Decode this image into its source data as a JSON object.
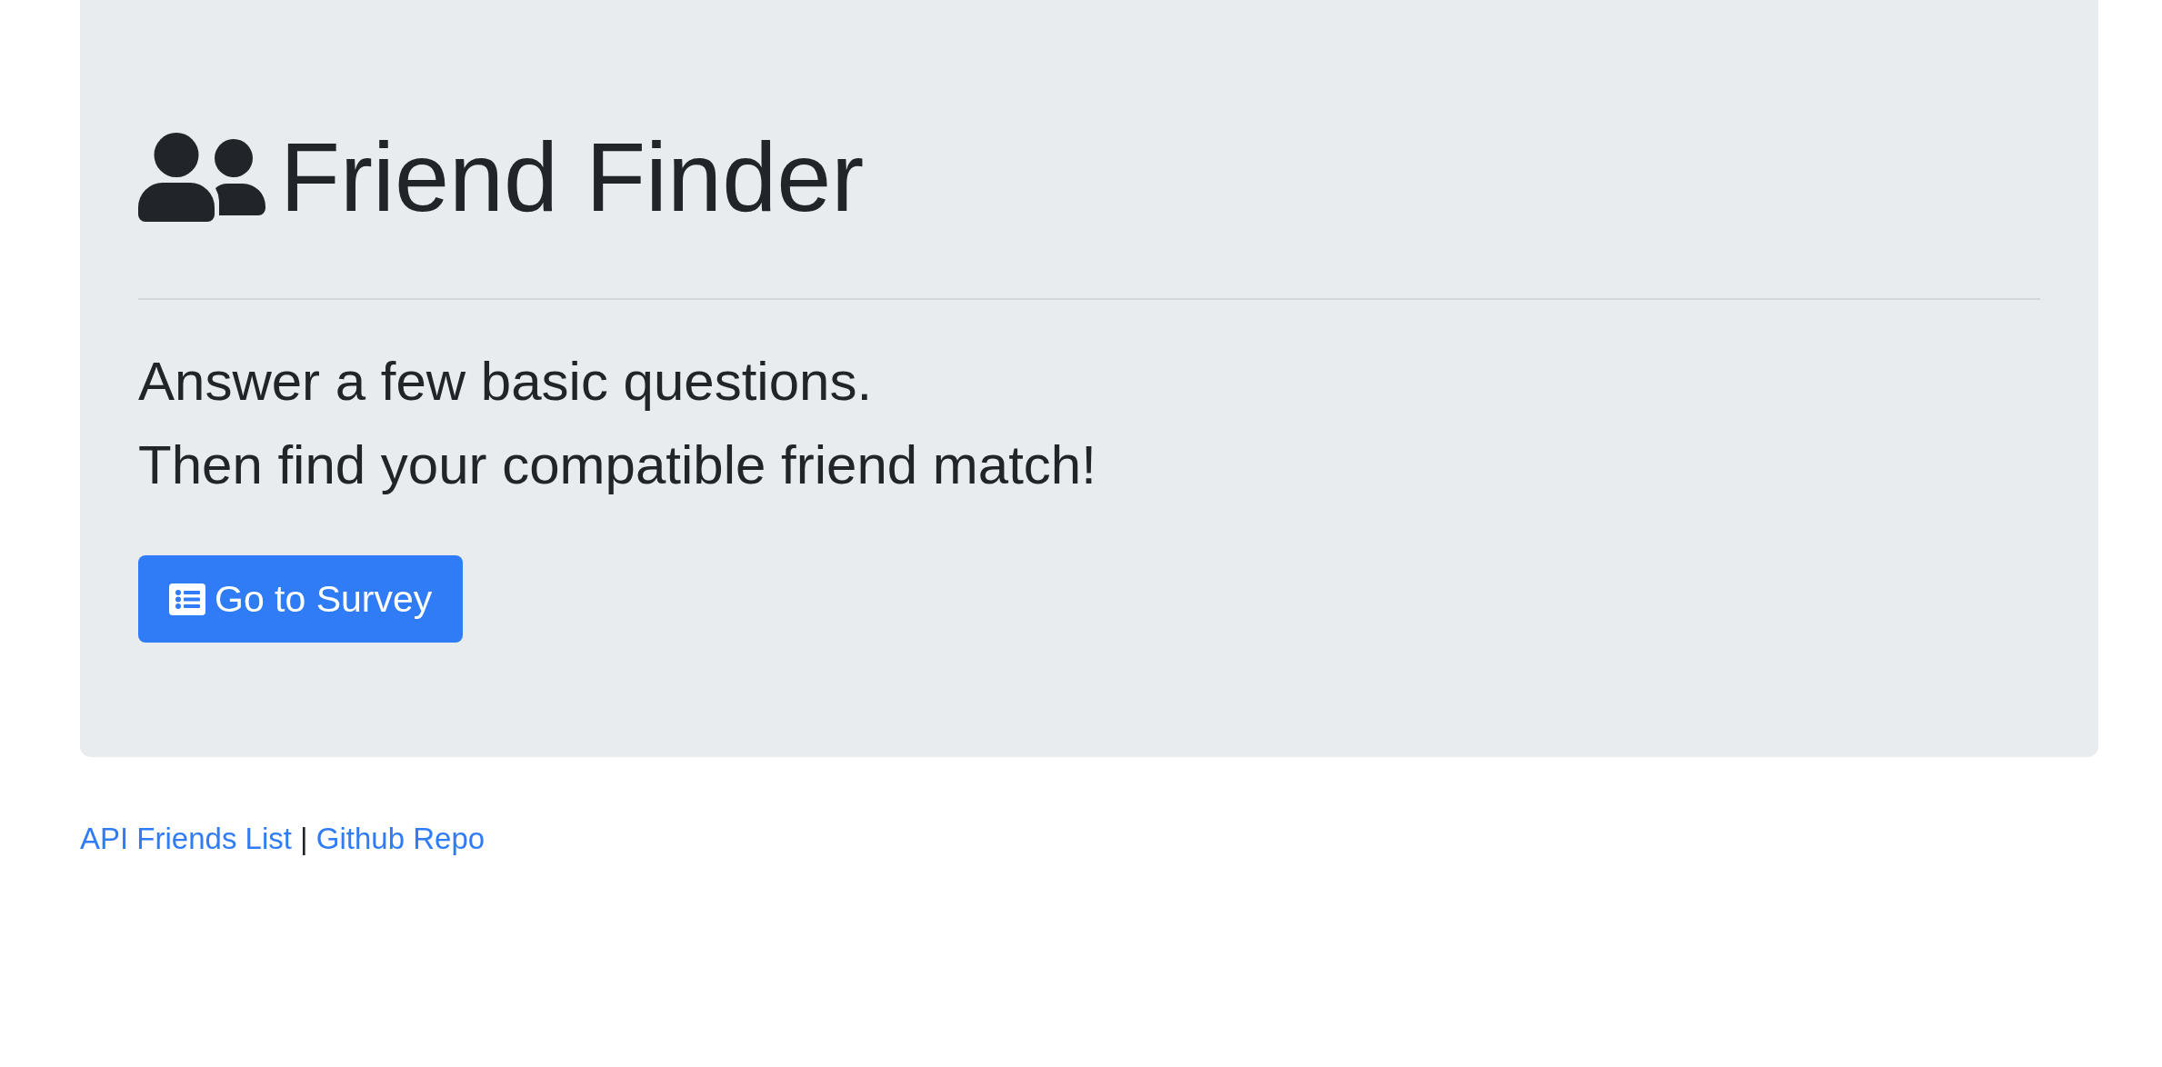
{
  "header": {
    "title": "Friend Finder"
  },
  "lead": [
    "Answer a few basic questions.",
    "Then find your compatible friend match!"
  ],
  "survey_button": {
    "label": "Go to Survey"
  },
  "footer": {
    "links": [
      "API Friends List",
      "Github Repo"
    ],
    "separator": "|"
  }
}
